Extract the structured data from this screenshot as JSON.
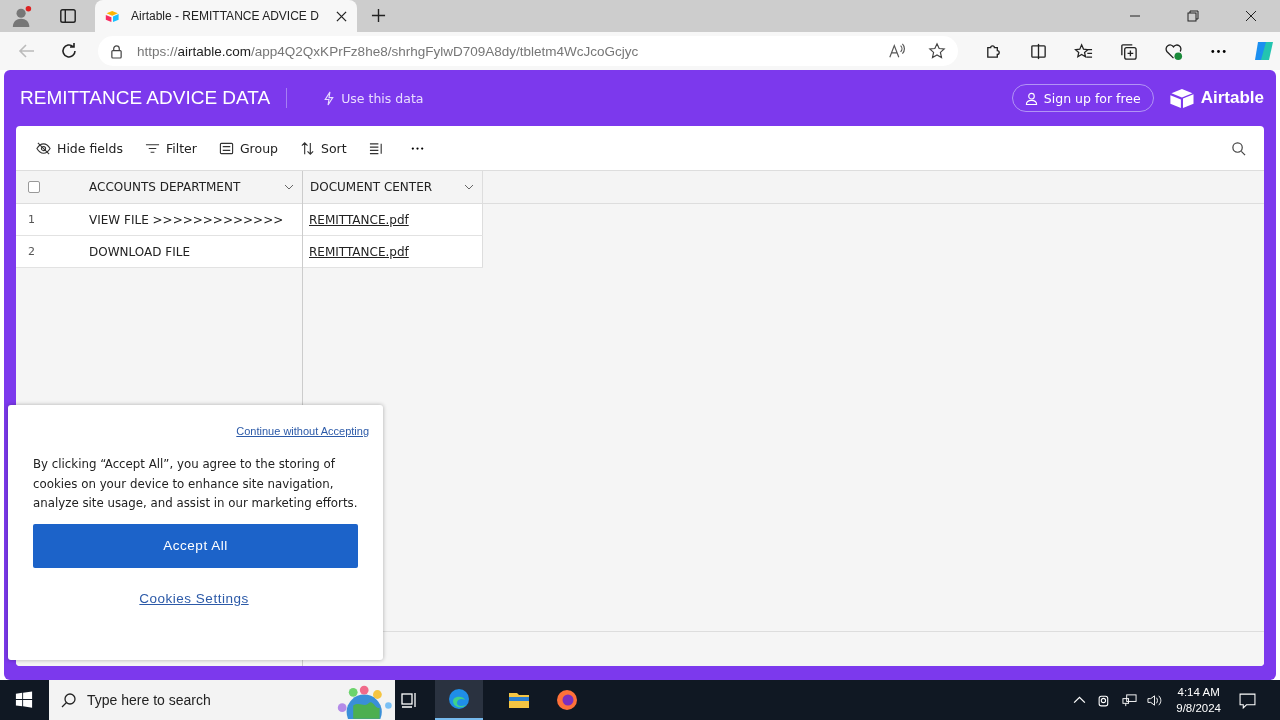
{
  "browser": {
    "tab_title": "Airtable - REMITTANCE ADVICE D",
    "url": {
      "scheme": "https://",
      "host": "airtable.com",
      "path": "/app4Q2QxKPrFz8he8/shrhgFylwD709A8dy/tbletm4WcJcoGcjyc"
    }
  },
  "header": {
    "title": "REMITTANCE ADVICE DATA",
    "use_data": "Use this data",
    "signup": "Sign up for free",
    "logo": "Airtable"
  },
  "toolbar": [
    {
      "kind": "hide",
      "label": "Hide fields"
    },
    {
      "kind": "filter",
      "label": "Filter"
    },
    {
      "kind": "group",
      "label": "Group"
    },
    {
      "kind": "sort",
      "label": "Sort"
    },
    {
      "kind": "height"
    }
  ],
  "table": {
    "select_all_checked": false,
    "columns": [
      "ACCOUNTS DEPARTMENT",
      "DOCUMENT CENTER"
    ],
    "rows": [
      {
        "number": "1",
        "cells": [
          "VIEW FILE >>>>>>>>>>>>>",
          "REMITTANCE.pdf"
        ]
      },
      {
        "number": "2",
        "cells": [
          "DOWNLOAD FILE",
          "REMITTANCE.pdf"
        ]
      }
    ]
  },
  "cookie_dialog": {
    "continue_link": "Continue without Accepting",
    "text": "By clicking “Accept All”, you agree to the storing of cookies on your device to enhance site navigation, analyze site usage, and assist in our marketing efforts.",
    "accept": "Accept All",
    "settings": "Cookies Settings"
  },
  "taskbar": {
    "search_placeholder": "Type here to search",
    "time": "4:14 AM",
    "date": "9/8/2024"
  }
}
